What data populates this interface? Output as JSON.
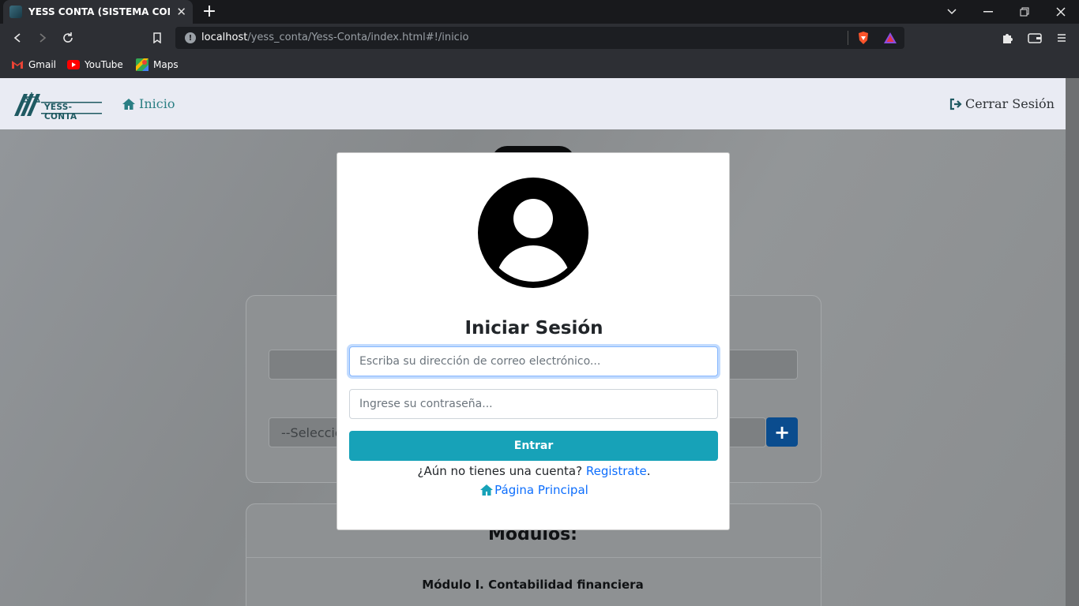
{
  "browser": {
    "tab_title": "YESS CONTA (SISTEMA CONTABL",
    "tab_close": "✕",
    "new_tab": "+",
    "url_host": "localhost",
    "url_path": "/yess_conta/Yess-Conta/index.html#!/inicio",
    "bookmarks": [
      {
        "label": "Gmail"
      },
      {
        "label": "YouTube"
      },
      {
        "label": "Maps"
      }
    ]
  },
  "navbar": {
    "logo_text": "YESS-CONTA",
    "inicio": "Inicio",
    "cerrar_sesion": "Cerrar Sesión"
  },
  "background": {
    "select_placeholder": "--Seleccio",
    "add_button": "+",
    "modulos_title": "Modulos:",
    "module_1": "Módulo I. Contabilidad financiera"
  },
  "login": {
    "title": "Iniciar Sesión",
    "email_placeholder": "Escriba su dirección de correo electrónico...",
    "password_placeholder": "Ingrese su contraseña...",
    "submit": "Entrar",
    "no_account": "¿Aún no tienes una cuenta?",
    "register": "Registrate",
    "period": ".",
    "home": "Página Principal"
  },
  "colors": {
    "accent": "#17a2b8",
    "link": "#0d6efd",
    "nav_teal": "#2b7f84"
  }
}
